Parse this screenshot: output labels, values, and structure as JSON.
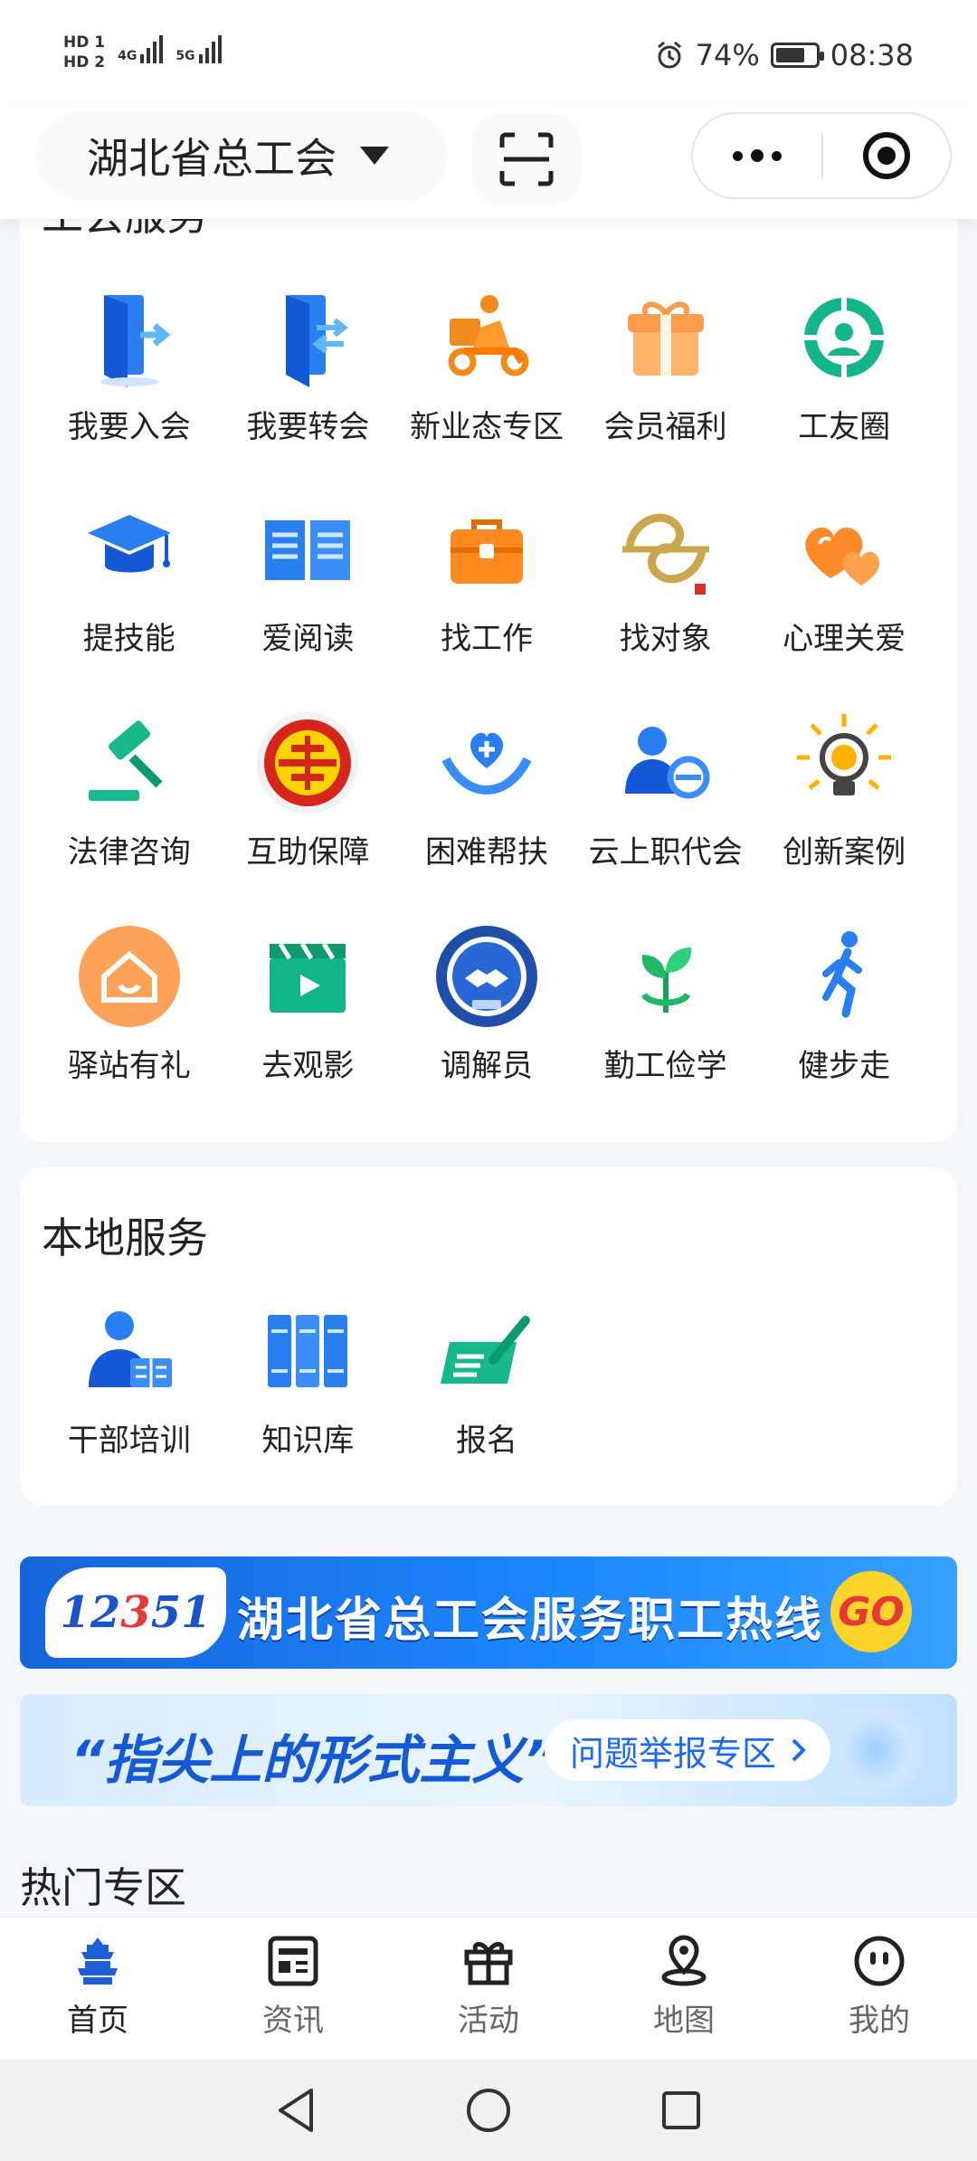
{
  "status_bar": {
    "hd1": "HD 1",
    "hd2": "HD 2",
    "net1": "4G",
    "net2": "5G",
    "battery": "74%",
    "time": "08:38"
  },
  "header": {
    "city": "湖北省总工会"
  },
  "union_services": {
    "title": "工会服务",
    "items": [
      {
        "label": "我要入会",
        "icon": "join-door-icon"
      },
      {
        "label": "我要转会",
        "icon": "transfer-door-icon"
      },
      {
        "label": "新业态专区",
        "icon": "delivery-rider-icon"
      },
      {
        "label": "会员福利",
        "icon": "gift-box-icon"
      },
      {
        "label": "工友圈",
        "icon": "worker-circle-icon"
      },
      {
        "label": "提技能",
        "icon": "graduation-cap-icon"
      },
      {
        "label": "爱阅读",
        "icon": "open-book-icon"
      },
      {
        "label": "找工作",
        "icon": "briefcase-icon"
      },
      {
        "label": "找对象",
        "icon": "matchmaking-logo-icon"
      },
      {
        "label": "心理关爱",
        "icon": "hearts-icon"
      },
      {
        "label": "法律咨询",
        "icon": "gavel-icon"
      },
      {
        "label": "互助保障",
        "icon": "union-emblem-icon"
      },
      {
        "label": "困难帮扶",
        "icon": "helping-hands-icon"
      },
      {
        "label": "云上职代会",
        "icon": "cloud-congress-icon"
      },
      {
        "label": "创新案例",
        "icon": "lightbulb-icon"
      },
      {
        "label": "驿站有礼",
        "icon": "station-house-icon"
      },
      {
        "label": "去观影",
        "icon": "clapperboard-icon"
      },
      {
        "label": "调解员",
        "icon": "mediator-badge-icon"
      },
      {
        "label": "勤工俭学",
        "icon": "sprout-icon"
      },
      {
        "label": "健步走",
        "icon": "runner-icon"
      }
    ]
  },
  "local_services": {
    "title": "本地服务",
    "items": [
      {
        "label": "干部培训",
        "icon": "cadre-training-icon"
      },
      {
        "label": "知识库",
        "icon": "knowledge-base-icon"
      },
      {
        "label": "报名",
        "icon": "signup-icon"
      }
    ]
  },
  "banners": {
    "hotline_logo_a": "12",
    "hotline_logo_b": "3",
    "hotline_logo_c": "51",
    "hotline_text": "湖北省总工会服务职工热线",
    "hotline_go": "GO",
    "report_text": "“指尖上的形式主义”",
    "report_button": "问题举报专区"
  },
  "hot_section": {
    "title": "热门专区"
  },
  "tabbar": {
    "items": [
      {
        "label": "首页",
        "icon": "home-tower-icon",
        "active": true
      },
      {
        "label": "资讯",
        "icon": "news-icon",
        "active": false
      },
      {
        "label": "活动",
        "icon": "gift-icon",
        "active": false
      },
      {
        "label": "地图",
        "icon": "map-pin-icon",
        "active": false
      },
      {
        "label": "我的",
        "icon": "profile-face-icon",
        "active": false
      }
    ]
  },
  "colors": {
    "accent": "#1d6af2",
    "brand_blue": "#1565d8",
    "active_tab": "#1e5fd8"
  }
}
